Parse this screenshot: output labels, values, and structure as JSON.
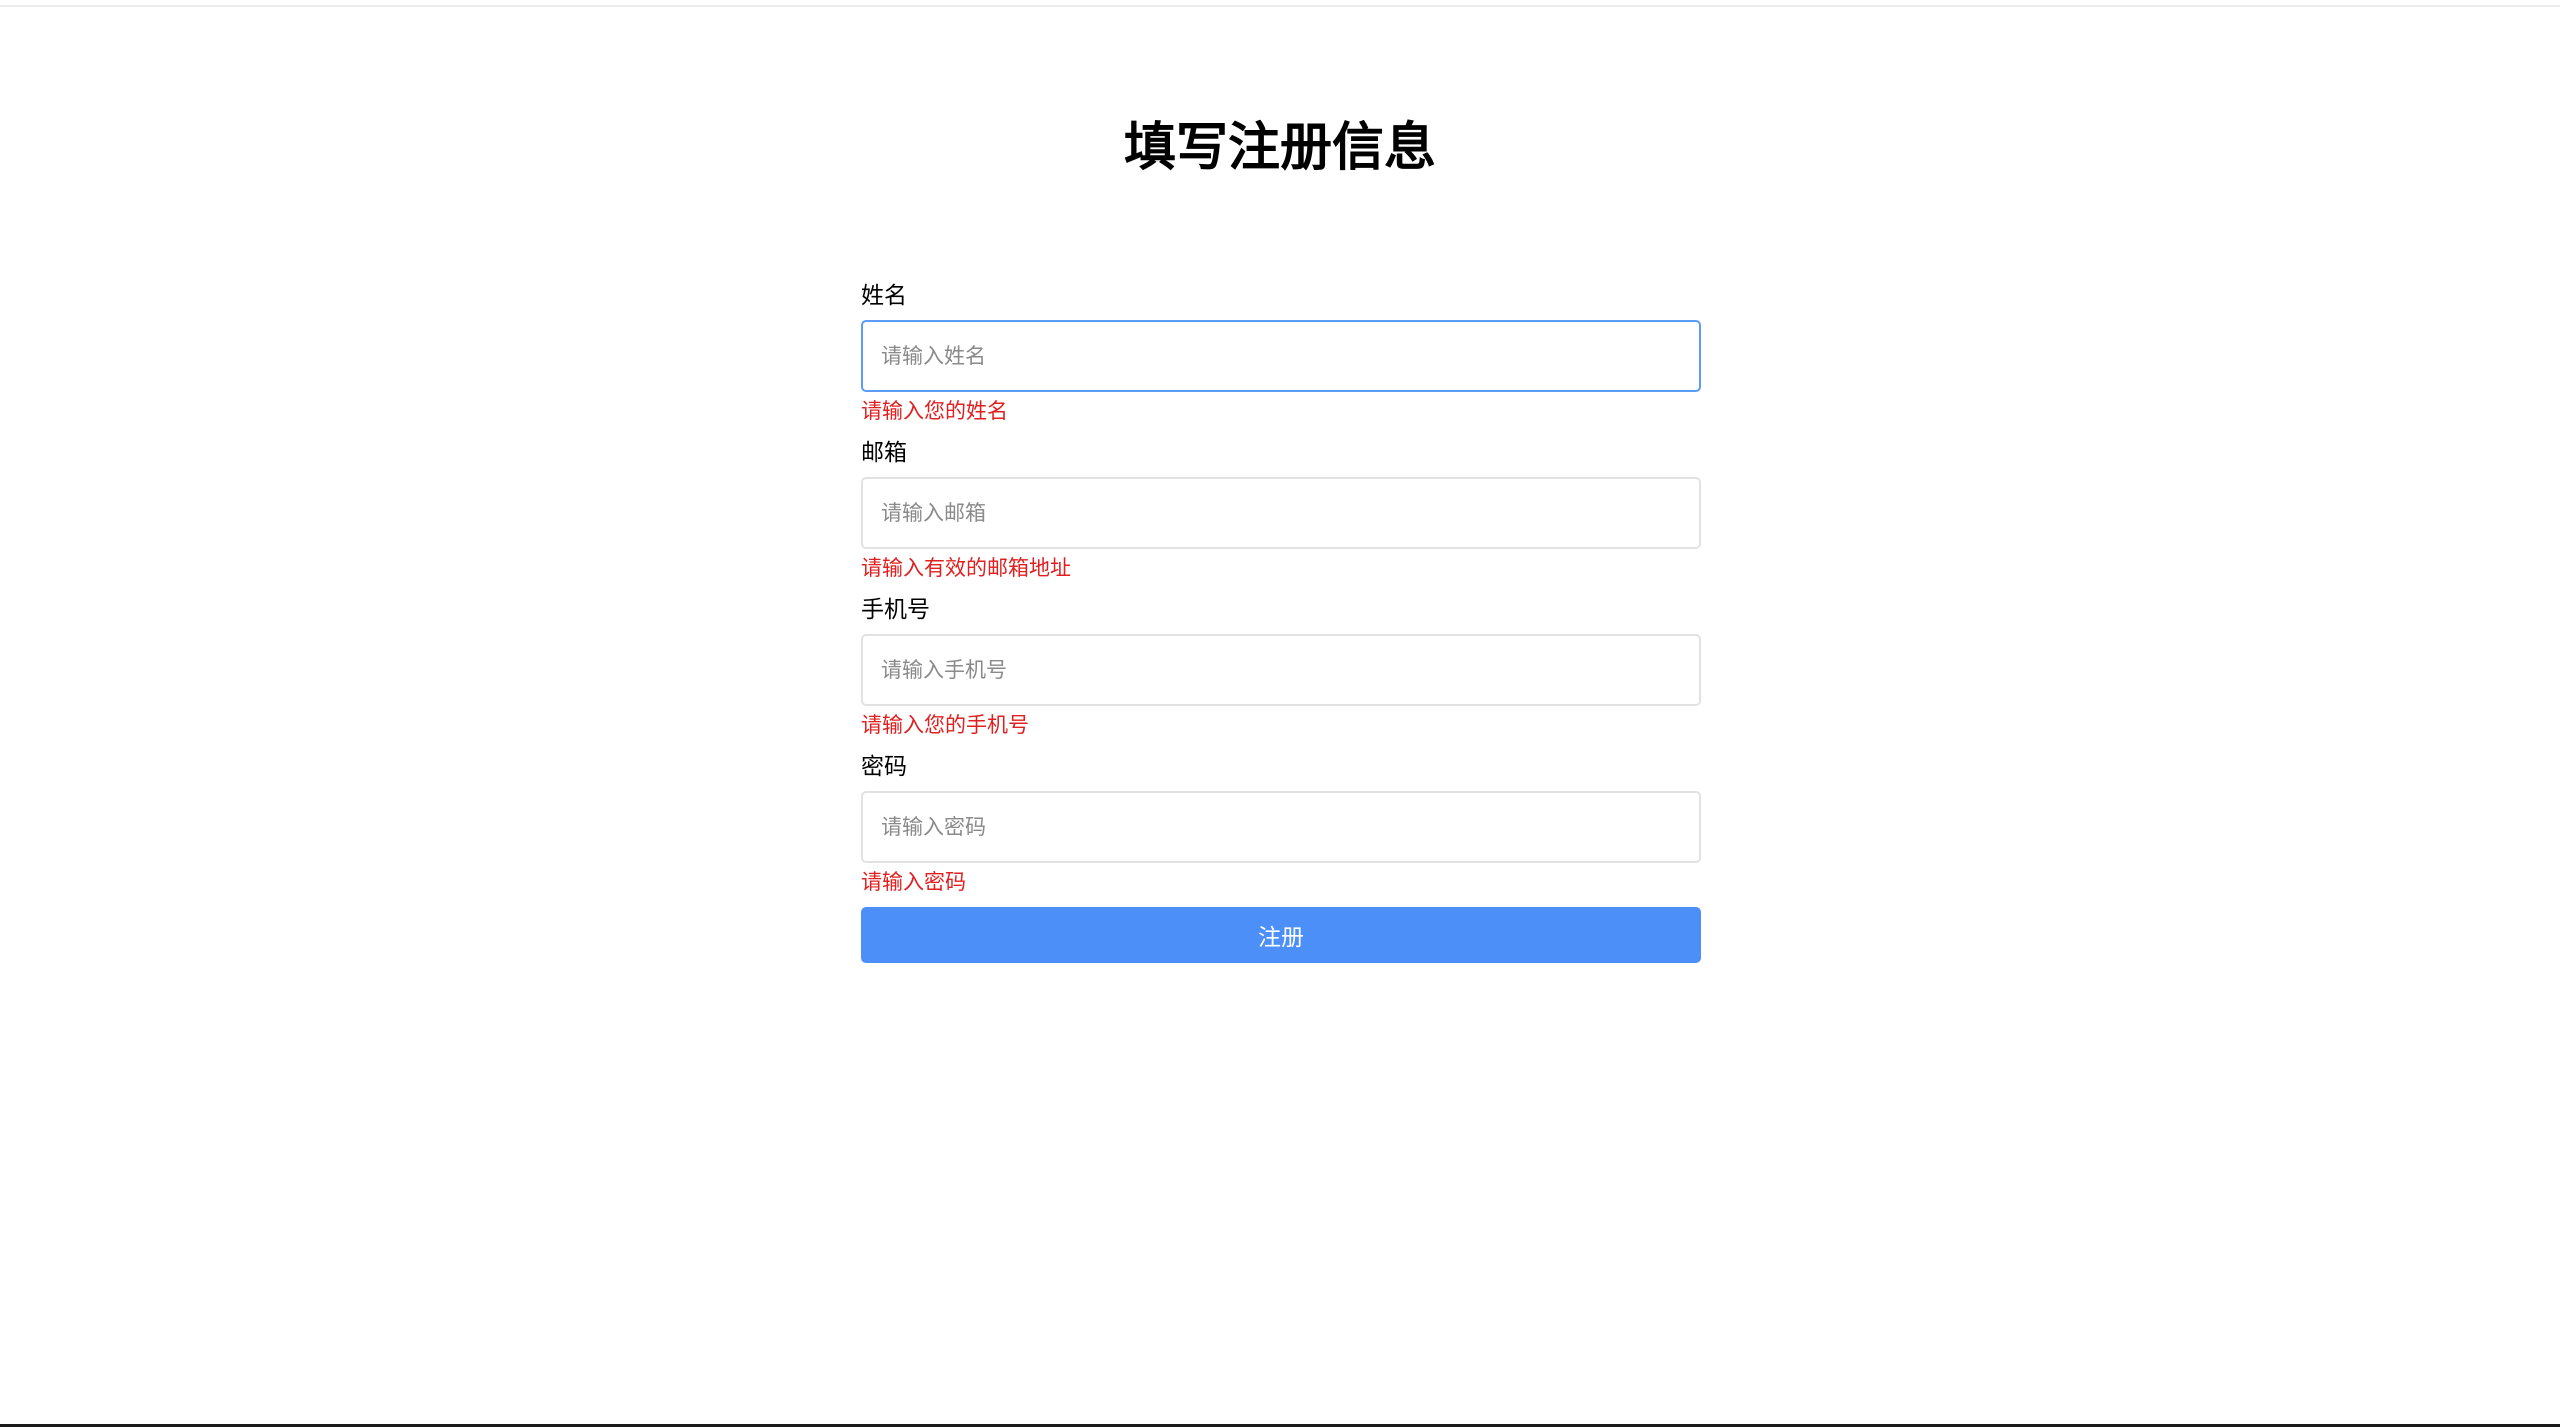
{
  "page": {
    "title": "填写注册信息"
  },
  "colors": {
    "error": "#e02020",
    "primary": "#4d8ff8",
    "focus_border": "#5b9cf6"
  },
  "form": {
    "fields": [
      {
        "label": "姓名",
        "placeholder": "请输入姓名",
        "value": "",
        "error": "请输入您的姓名",
        "focused": true
      },
      {
        "label": "邮箱",
        "placeholder": "请输入邮箱",
        "value": "",
        "error": "请输入有效的邮箱地址",
        "focused": false
      },
      {
        "label": "手机号",
        "placeholder": "请输入手机号",
        "value": "",
        "error": "请输入您的手机号",
        "focused": false
      },
      {
        "label": "密码",
        "placeholder": "请输入密码",
        "value": "",
        "error": "请输入密码",
        "focused": false
      }
    ],
    "submit_label": "注册"
  }
}
